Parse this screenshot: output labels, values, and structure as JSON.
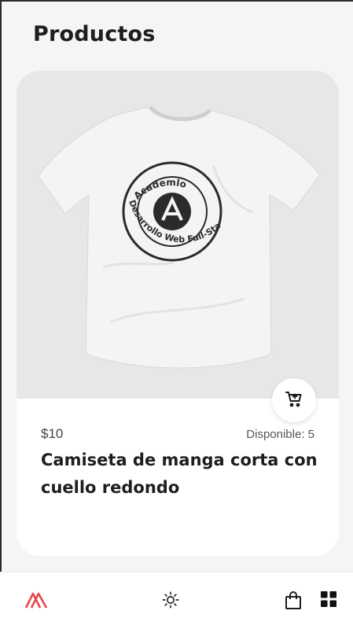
{
  "header": {
    "title": "Productos"
  },
  "product": {
    "price": "$10",
    "availability": "Disponible: 5",
    "name": "Camiseta de manga corta con cuello redondo",
    "shirt_print": {
      "top_text": "Academlo",
      "bottom_text": "Desarrollo Web Full-Stack"
    }
  },
  "nav": {
    "items": [
      {
        "icon": "academlo-logo-icon"
      },
      {
        "icon": "sun-icon"
      },
      {
        "icon": "shopping-bag-icon"
      },
      {
        "icon": "grid-icon"
      }
    ]
  },
  "colors": {
    "background": "#f5f5f5",
    "card": "#ffffff",
    "image_bg": "#e7e7e7",
    "text": "#1e1e1e",
    "logo_accent": "#e5484d"
  }
}
